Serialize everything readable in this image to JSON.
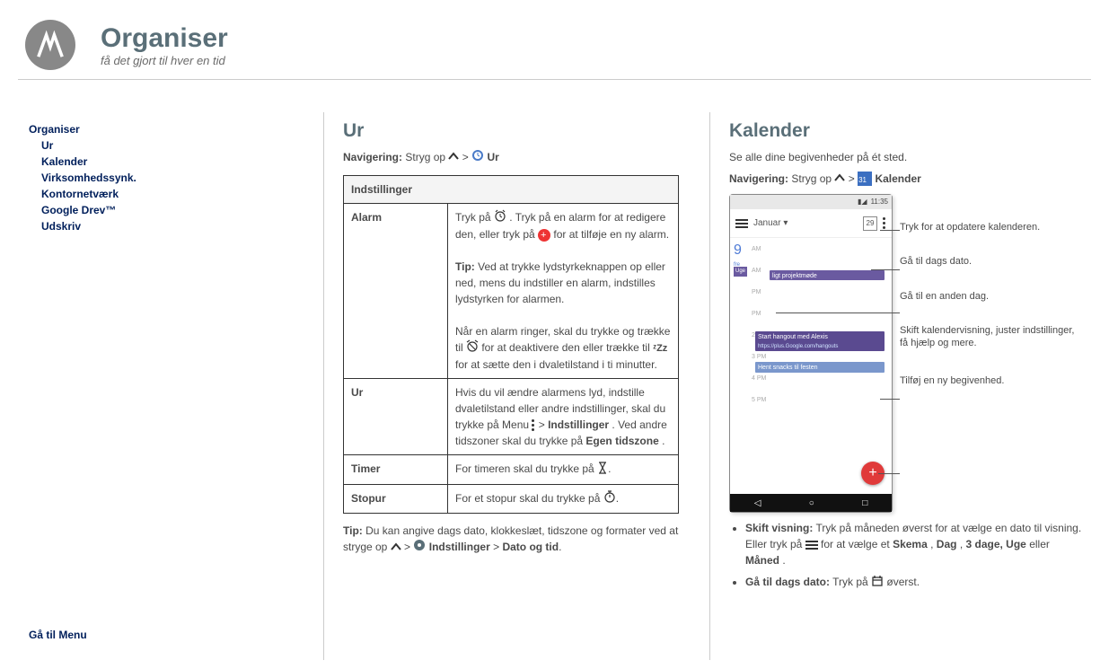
{
  "header": {
    "title": "Organiser",
    "subtitle": "få det gjort til hver en tid"
  },
  "sidebar": {
    "top": "Organiser",
    "items": [
      "Ur",
      "Kalender",
      "Virksomhedssynk.",
      "Kontornetværk",
      "Google Drev™",
      "Udskriv"
    ],
    "go_menu": "Gå til Menu"
  },
  "col1": {
    "heading": "Ur",
    "nav_label": "Navigering:",
    "nav_swipe": "Stryg op",
    "nav_app": "Ur",
    "table_header": "Indstillinger",
    "rows": {
      "alarm": {
        "label": "Alarm",
        "p1a": "Tryk på ",
        "p1b": ". Tryk på en alarm for at redigere den, eller tryk på ",
        "p1c": " for at tilføje en ny alarm.",
        "tip_label": "Tip:",
        "tip_text": " Ved at trykke lydstyrkeknappen op eller ned, mens du indstiller en alarm, indstilles lydstyrken for alarmen.",
        "p2a": "Når en alarm ringer, skal du trykke og trække til ",
        "p2b": " for at deaktivere den eller trække til ",
        "p2c": " for at sætte den i dvaletilstand i ti minutter.",
        "zzz": "ᶻZᴢ"
      },
      "ur": {
        "label": "Ur",
        "p1": "Hvis du vil ændre alarmens lyd, indstille dvaletilstand eller andre indstillinger, skal du trykke på Menu ",
        "p2": " > ",
        "p3": "Indstillinger",
        "p4": ". Ved andre tidszoner skal du trykke på ",
        "p5": "Egen tidszone",
        "p6": "."
      },
      "timer": {
        "label": "Timer",
        "text": "For timeren skal du trykke på "
      },
      "stopur": {
        "label": "Stopur",
        "text": "For et stopur skal du trykke på "
      }
    },
    "tip_footer_label": "Tip:",
    "tip_footer_text": " Du kan angive dags dato, klokkeslæt, tidszone og formater ved at stryge op ",
    "tip_footer_settings": "Indstillinger",
    "tip_footer_datetime": "Dato og tid"
  },
  "col2": {
    "heading": "Kalender",
    "intro": "Se alle dine begivenheder på ét sted.",
    "nav_label": "Navigering:",
    "nav_swipe": "Stryg op",
    "nav_app": "Kalender",
    "bullets": {
      "b1_label": "Skift visning:",
      "b1a": " Tryk på måneden øverst for at vælge en dato til visning. Eller tryk på ",
      "b1b": " for at vælge et ",
      "b1_schema": "Skema",
      "b1c": ", ",
      "b1_day": "Dag",
      "b1d": ", ",
      "b1_3day": "3 dage, Uge",
      "b1e": " eller ",
      "b1_month": "Måned",
      "b1f": ".",
      "b2_label": "Gå til dags dato:",
      "b2a": " Tryk på ",
      "b2b": " øverst."
    }
  },
  "phone": {
    "time": "11:35",
    "month": "Januar",
    "daynum": "29",
    "bignum": "9",
    "bignum_sub": "fre",
    "week_label": "Uge",
    "event1": "ligt projektmøde",
    "event2_title": "Start hangout med Alexis",
    "event2_url": "https://plus.Google.com/hangouts",
    "event3": "Hent snacks til festen",
    "hours": [
      "AM",
      "AM",
      "PM",
      "PM",
      "2 PM",
      "3 PM",
      "4 PM",
      "5 PM"
    ]
  },
  "callouts": {
    "c1": "Tryk for at opdatere kalenderen.",
    "c2": "Gå til dags dato.",
    "c3": "Gå til en anden dag.",
    "c4": "Skift kalendervisning, juster indstillinger, få hjælp og mere.",
    "c5": "Tilføj en ny begivenhed."
  }
}
